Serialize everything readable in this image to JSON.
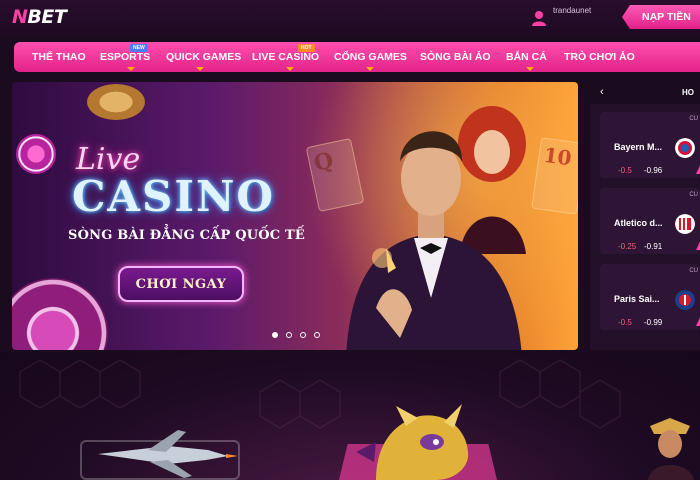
{
  "header": {
    "logo_prefix": "N",
    "logo_text": "BET",
    "username": "trandaunet",
    "deposit_label": "NẠP TIỀN"
  },
  "nav": {
    "items": [
      {
        "label": "THỂ THAO",
        "badge": ""
      },
      {
        "label": "ESPORTS",
        "badge": "NEW"
      },
      {
        "label": "QUICK GAMES",
        "badge": ""
      },
      {
        "label": "LIVE CASINO",
        "badge": "HOT"
      },
      {
        "label": "CỔNG GAMES",
        "badge": ""
      },
      {
        "label": "SÒNG BÀI ẢO",
        "badge": ""
      },
      {
        "label": "BẮN CÁ",
        "badge": ""
      },
      {
        "label": "TRÒ CHƠI ẢO",
        "badge": ""
      }
    ]
  },
  "banner": {
    "live": "Live",
    "casino": "CASINO",
    "tagline": "SÒNG BÀI ĐẲNG CẤP QUỐC TẾ",
    "cta": "CHƠI NGAY",
    "card_q": "Q",
    "card_10": "10",
    "slide_count": 4,
    "active_slide": 1
  },
  "sports": {
    "back": "‹",
    "tab": "HO",
    "matches": [
      {
        "league": "CU",
        "team": "Bayern M...",
        "odd_a": "-0.5",
        "odd_b": "-0.96"
      },
      {
        "league": "CU",
        "team": "Atletico d...",
        "odd_a": "-0.25",
        "odd_b": "-0.91"
      },
      {
        "league": "CU",
        "team": "Paris Sai...",
        "odd_a": "-0.5",
        "odd_b": "-0.99"
      }
    ]
  },
  "colors": {
    "accent": "#ff3fa4",
    "background": "#1a0b1f",
    "gold": "#ffb300"
  }
}
